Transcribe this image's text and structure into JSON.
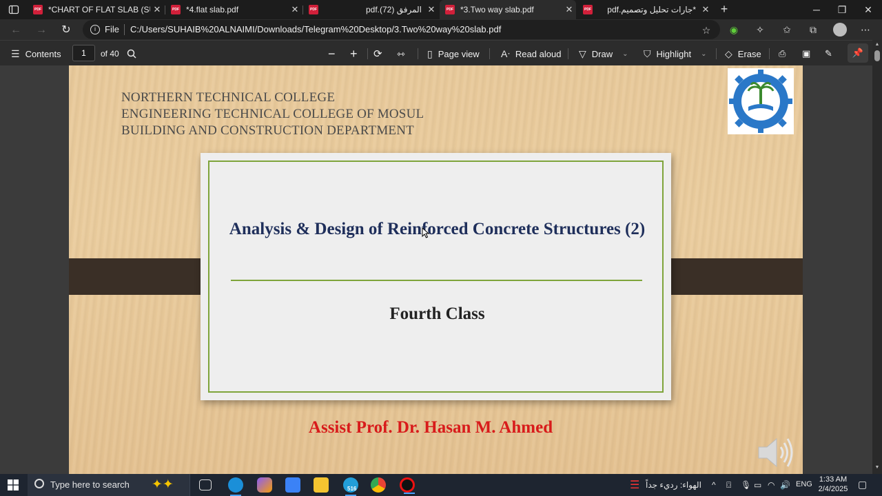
{
  "browser": {
    "tabs": [
      {
        "title": "*CHART OF FLAT SLAB (SUHAIB",
        "active": false
      },
      {
        "title": "*4.flat slab.pdf",
        "active": false
      },
      {
        "title": "pdf.(72) المرفق",
        "active": false
      },
      {
        "title": "*3.Two way slab.pdf",
        "active": true
      },
      {
        "title": "pdf.جارات تحليل وتصميم*",
        "active": false
      }
    ],
    "address": {
      "label": "File",
      "url": "C:/Users/SUHAIB%20ALNAIMI/Downloads/Telegram%20Desktop/3.Two%20way%20slab.pdf"
    }
  },
  "pdf_toolbar": {
    "contents_label": "Contents",
    "page_current": "1",
    "page_total": "of 40",
    "page_view_label": "Page view",
    "read_aloud_label": "Read aloud",
    "draw_label": "Draw",
    "highlight_label": "Highlight",
    "erase_label": "Erase"
  },
  "slide": {
    "institution_lines": [
      "NORTHERN TECHNICAL COLLEGE",
      "ENGINEERING TECHNICAL COLLEGE OF MOSUL",
      "BUILDING AND CONSTRUCTION DEPARTMENT"
    ],
    "title": "Analysis & Design of Reinforced Concrete Structures (2)",
    "subtitle": "Fourth Class",
    "author": "Assist Prof. Dr. Hasan M. Ahmed"
  },
  "taskbar": {
    "search_placeholder": "Type here to search",
    "weather": "الهواء: رديء جداً",
    "language": "ENG",
    "time": "1:33 AM",
    "date": "2/4/2025",
    "telegram_badge": "516"
  },
  "colors": {
    "slide_title": "#1f2f5b",
    "author": "#d81b1b",
    "card_border": "#7ea43a",
    "pdf_icon": "#d1203a"
  }
}
